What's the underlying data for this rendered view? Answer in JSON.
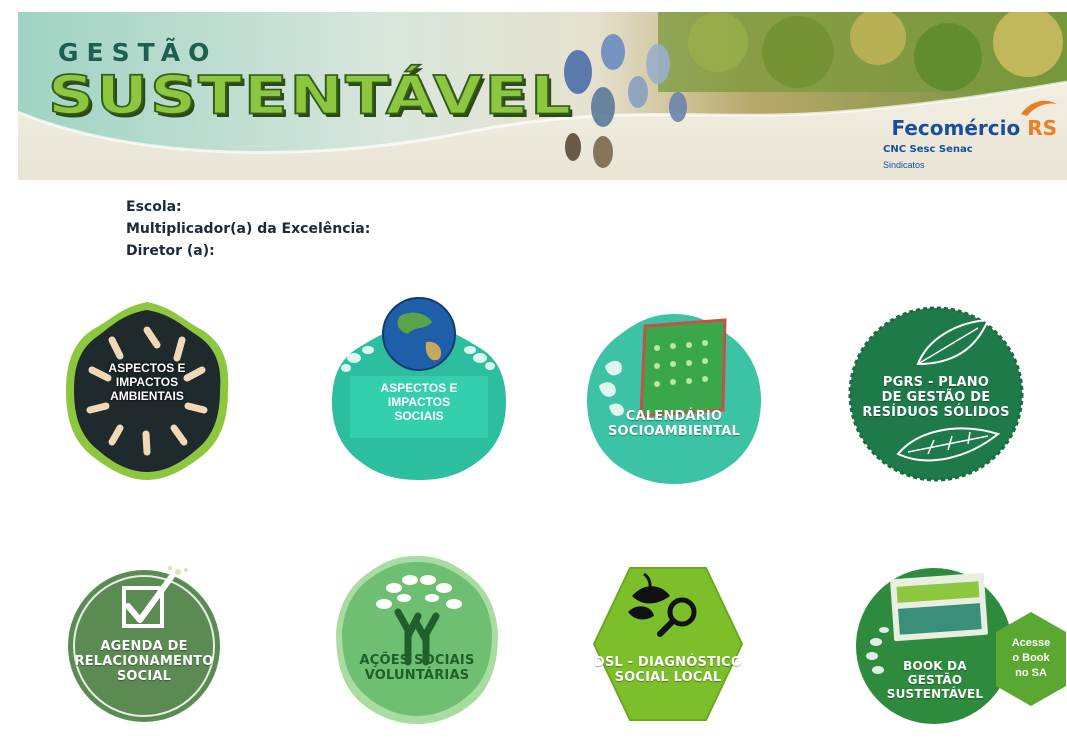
{
  "header": {
    "title_small": "GESTÃO",
    "title_big": "SUSTENTÁVEL",
    "partner": {
      "name": "Fecomércio",
      "region": "RS",
      "subline": "CNC Sesc Senac",
      "note": "Sindicatos"
    },
    "colors": {
      "title_green": "#8dc63f",
      "title_dark": "#1f5f52",
      "partner_blue": "#1b4e9a",
      "partner_orange": "#ee7d20"
    }
  },
  "info": {
    "school_label": "Escola:",
    "multiplier_label": "Multiplicador(a) da Excelência:",
    "director_label": "Diretor (a):"
  },
  "badges": [
    {
      "label": "ASPECTOS E\nIMPACTOS\nAMBIENTAIS",
      "icon": "holding-hands-circle-icon",
      "color": "#1e2a2c"
    },
    {
      "label": "ASPECTOS E\nIMPACTOS\nSOCIAIS",
      "icon": "earth-globe-icon",
      "color": "#2bbfa0"
    },
    {
      "label": "CALENDÁRIO\nSOCIOAMBIENTAL",
      "icon": "desk-calendar-icon",
      "color": "#3cc3a6"
    },
    {
      "label": "PGRS - PLANO\nDE GESTÃO DE\nRESÍDUOS SÓLIDOS",
      "icon": "leaf-icon",
      "color": "#1f7a4a"
    },
    {
      "label": "AGENDA DE\nRELACIONAMENTO\nSOCIAL",
      "icon": "checkbox-icon",
      "color": "#5b8a52"
    },
    {
      "label": "AÇÕES SOCIAIS\nVOLUNTÁRIAS",
      "icon": "tree-hand-icon",
      "color": "#6fbf73"
    },
    {
      "label": "DSL - DIAGNÓSTICO\nSOCIAL LOCAL",
      "icon": "magnifier-leaf-icon",
      "color": "#7cbf2a"
    },
    {
      "label": "BOOK DA\nGESTÃO\nSUSTENTÁVEL",
      "icon": "book-icon",
      "color": "#2e8b3e"
    }
  ],
  "acesse_button": {
    "label": "Acesse\no Book\nno SA",
    "color": "#5aa832"
  }
}
